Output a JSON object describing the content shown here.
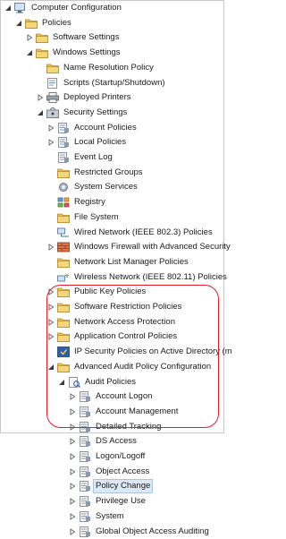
{
  "tree": [
    {
      "label": "Computer Configuration",
      "level": 0,
      "expanded": true,
      "icon": "computer-icon"
    },
    {
      "label": "Policies",
      "level": 1,
      "expanded": true,
      "icon": "folder-icon"
    },
    {
      "label": "Software Settings",
      "level": 2,
      "expanded": false,
      "icon": "folder-icon"
    },
    {
      "label": "Windows Settings",
      "level": 2,
      "expanded": true,
      "icon": "folder-icon"
    },
    {
      "label": "Name Resolution Policy",
      "level": 3,
      "expanded": null,
      "icon": "folder-icon"
    },
    {
      "label": "Scripts (Startup/Shutdown)",
      "level": 3,
      "expanded": null,
      "icon": "script-icon"
    },
    {
      "label": "Deployed Printers",
      "level": 3,
      "expanded": false,
      "icon": "printer-icon"
    },
    {
      "label": "Security Settings",
      "level": 3,
      "expanded": true,
      "icon": "security-icon"
    },
    {
      "label": "Account Policies",
      "level": 4,
      "expanded": false,
      "icon": "policy-icon"
    },
    {
      "label": "Local Policies",
      "level": 4,
      "expanded": false,
      "icon": "policy-icon"
    },
    {
      "label": "Event Log",
      "level": 4,
      "expanded": null,
      "icon": "policy-icon"
    },
    {
      "label": "Restricted Groups",
      "level": 4,
      "expanded": null,
      "icon": "folder-icon"
    },
    {
      "label": "System Services",
      "level": 4,
      "expanded": null,
      "icon": "services-icon"
    },
    {
      "label": "Registry",
      "level": 4,
      "expanded": null,
      "icon": "registry-icon"
    },
    {
      "label": "File System",
      "level": 4,
      "expanded": null,
      "icon": "folder-icon"
    },
    {
      "label": "Wired Network (IEEE 802.3) Policies",
      "level": 4,
      "expanded": null,
      "icon": "wired-network-icon"
    },
    {
      "label": "Windows Firewall with Advanced Security",
      "level": 4,
      "expanded": false,
      "icon": "firewall-icon"
    },
    {
      "label": "Network List Manager Policies",
      "level": 4,
      "expanded": null,
      "icon": "folder-icon"
    },
    {
      "label": "Wireless Network (IEEE 802.11) Policies",
      "level": 4,
      "expanded": null,
      "icon": "wireless-network-icon"
    },
    {
      "label": "Public Key Policies",
      "level": 4,
      "expanded": false,
      "icon": "folder-icon"
    },
    {
      "label": "Software Restriction Policies",
      "level": 4,
      "expanded": false,
      "icon": "folder-icon"
    },
    {
      "label": "Network Access Protection",
      "level": 4,
      "expanded": false,
      "icon": "folder-icon"
    },
    {
      "label": "Application Control Policies",
      "level": 4,
      "expanded": false,
      "icon": "folder-icon"
    },
    {
      "label": "IP Security Policies on Active Directory (m",
      "level": 4,
      "expanded": null,
      "icon": "ipsec-icon"
    },
    {
      "label": "Advanced Audit Policy Configuration",
      "level": 4,
      "expanded": true,
      "icon": "folder-icon"
    },
    {
      "label": "Audit Policies",
      "level": 5,
      "expanded": true,
      "icon": "audit-icon"
    },
    {
      "label": "Account Logon",
      "level": 6,
      "expanded": false,
      "icon": "policy-icon"
    },
    {
      "label": "Account Management",
      "level": 6,
      "expanded": false,
      "icon": "policy-icon"
    },
    {
      "label": "Detailed Tracking",
      "level": 6,
      "expanded": false,
      "icon": "policy-icon"
    },
    {
      "label": "DS Access",
      "level": 6,
      "expanded": false,
      "icon": "policy-icon"
    },
    {
      "label": "Logon/Logoff",
      "level": 6,
      "expanded": false,
      "icon": "policy-icon"
    },
    {
      "label": "Object Access",
      "level": 6,
      "expanded": false,
      "icon": "policy-icon"
    },
    {
      "label": "Policy Change",
      "level": 6,
      "expanded": false,
      "icon": "policy-icon",
      "selected": true
    },
    {
      "label": "Privilege Use",
      "level": 6,
      "expanded": false,
      "icon": "policy-icon"
    },
    {
      "label": "System",
      "level": 6,
      "expanded": false,
      "icon": "policy-icon"
    },
    {
      "label": "Global Object Access Auditing",
      "level": 6,
      "expanded": false,
      "icon": "policy-icon"
    }
  ],
  "colors": {
    "highlight": "#e11d2b",
    "folder": "#e9c45b",
    "selection": "#dde8f5"
  }
}
